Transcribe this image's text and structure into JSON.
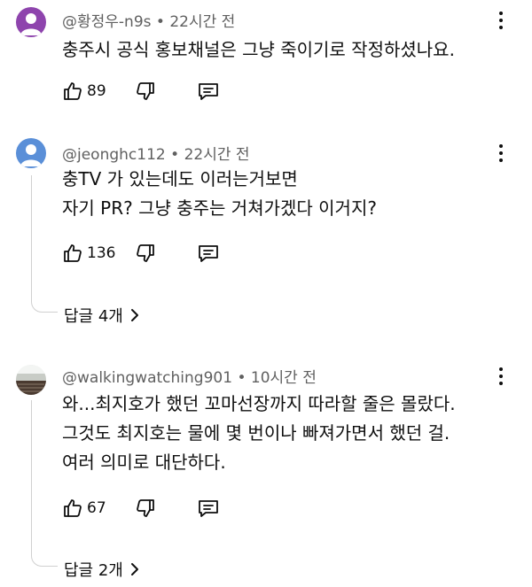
{
  "comments": [
    {
      "author": "@황정우-n9s",
      "time": "22시간 전",
      "lines": [
        "충주시 공식 홍보채널은 그냥 죽이기로 작정하셨나요."
      ],
      "likes": "89",
      "avatar_color": "#8e44ad"
    },
    {
      "author": "@jeonghc112",
      "time": "22시간 전",
      "lines": [
        "충TV 가 있는데도 이러는거보면",
        "자기 PR? 그냥 충주는 거쳐가겠다 이거지?"
      ],
      "likes": "136",
      "replies": "답글 4개",
      "avatar_color": "#5a8fd8"
    },
    {
      "author": "@walkingwatching901",
      "time": "10시간 전",
      "lines": [
        "와...최지호가 했던 꼬마선장까지 따라할 줄은 몰랐다.",
        "그것도 최지호는 물에 몇 번이나 빠져가면서 했던 걸.",
        "여러 의미로 대단하다."
      ],
      "likes": "67",
      "replies": "답글 2개"
    }
  ],
  "separator": "•",
  "icons": {
    "like": "thumbs-up-icon",
    "dislike": "thumbs-down-icon",
    "reply": "reply-comment-icon",
    "more": "more-vertical-icon",
    "expand": "chevron-right-icon"
  }
}
